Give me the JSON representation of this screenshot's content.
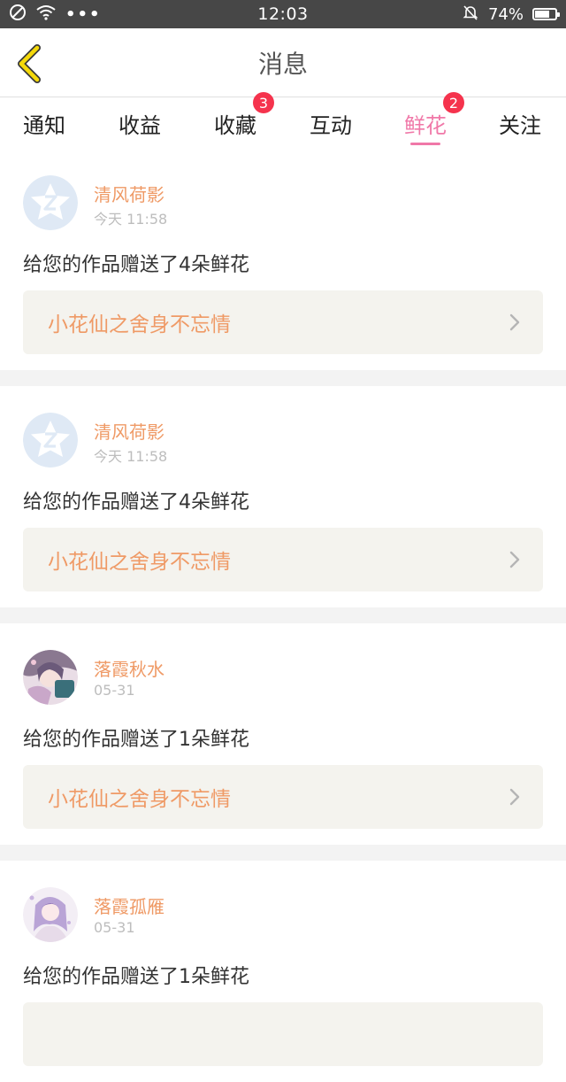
{
  "status_bar": {
    "time": "12:03",
    "battery": "74%",
    "battery_level": 0.74,
    "more_dots": "•••"
  },
  "header": {
    "title": "消息"
  },
  "tabs": [
    {
      "label": "通知"
    },
    {
      "label": "收益"
    },
    {
      "label": "收藏",
      "badge": "3"
    },
    {
      "label": "互动"
    },
    {
      "label": "鲜花",
      "badge": "2",
      "active": true
    },
    {
      "label": "关注"
    }
  ],
  "messages": [
    {
      "user": "清风荷影",
      "time": "今天 11:58",
      "text": "给您的作品赠送了4朵鲜花",
      "work": "小花仙之舍身不忘情",
      "avatar": "default-avatar"
    },
    {
      "user": "清风荷影",
      "time": "今天 11:58",
      "text": "给您的作品赠送了4朵鲜花",
      "work": "小花仙之舍身不忘情",
      "avatar": "default-avatar"
    },
    {
      "user": "落霞秋水",
      "time": "05-31",
      "text": "给您的作品赠送了1朵鲜花",
      "work": "小花仙之舍身不忘情",
      "avatar": "anime-avatar-1"
    },
    {
      "user": "落霞孤雁",
      "time": "05-31",
      "text": "给您的作品赠送了1朵鲜花",
      "work": "",
      "avatar": "anime-avatar-2"
    }
  ],
  "colors": {
    "accent_pink": "#f078a8",
    "username_orange": "#ef9a66",
    "badge_red": "#f5334d",
    "back_arrow_yellow": "#f5d90a",
    "status_bar_bg": "#474747"
  }
}
